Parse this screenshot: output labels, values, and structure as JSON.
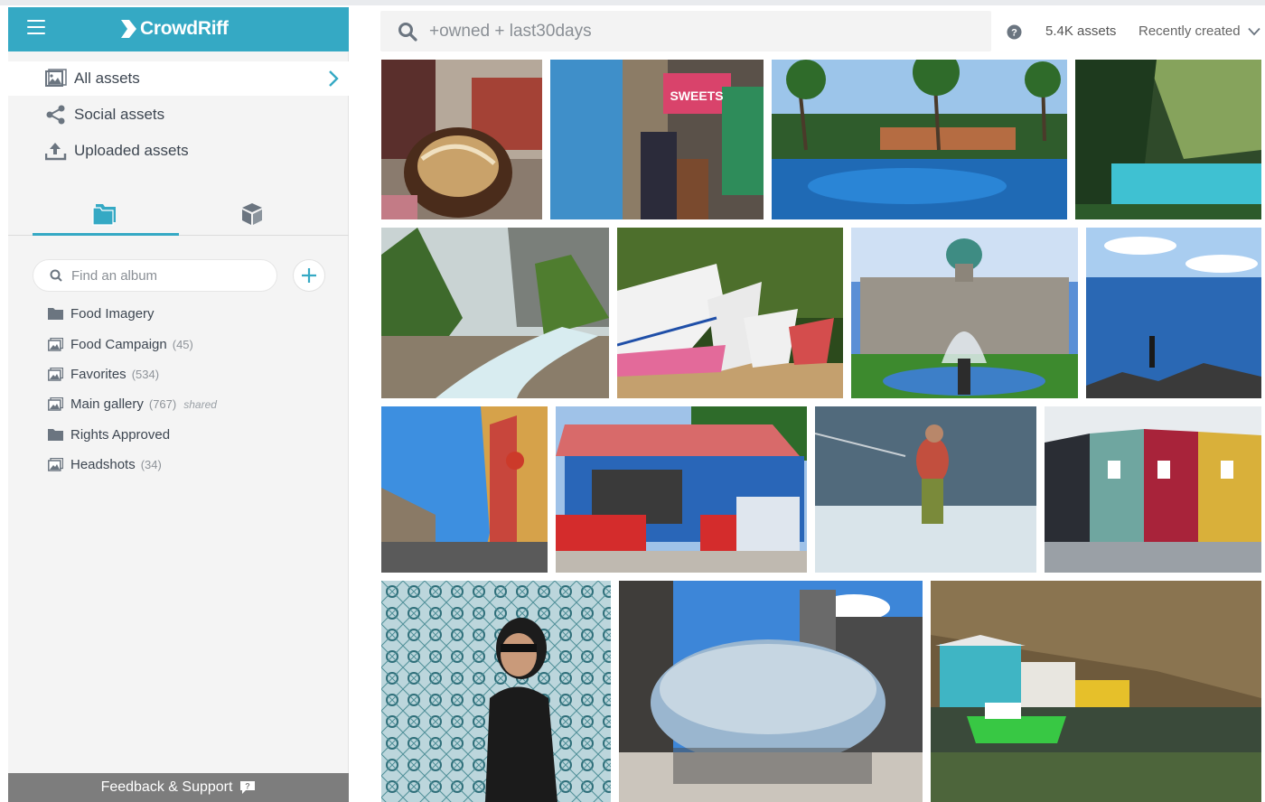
{
  "app": {
    "brand_name": "CrowdRiff",
    "brand_color": "#35a9c4"
  },
  "nav": {
    "items": [
      {
        "label": "All assets",
        "icon": "image-icon",
        "active": true
      },
      {
        "label": "Social assets",
        "icon": "share-icon",
        "active": false
      },
      {
        "label": "Uploaded assets",
        "icon": "upload-icon",
        "active": false
      }
    ]
  },
  "tabs": [
    {
      "icon": "folder-icon",
      "active": true
    },
    {
      "icon": "cube-icon",
      "active": false
    }
  ],
  "album_search": {
    "placeholder": "Find an album"
  },
  "albums": [
    {
      "name": "Food Imagery",
      "icon": "folder-icon",
      "count": "",
      "shared": ""
    },
    {
      "name": "Food Campaign",
      "icon": "gallery-icon",
      "count": "(45)",
      "shared": ""
    },
    {
      "name": "Favorites",
      "icon": "gallery-icon",
      "count": "(534)",
      "shared": ""
    },
    {
      "name": "Main gallery",
      "icon": "gallery-icon",
      "count": "(767)",
      "shared": "shared"
    },
    {
      "name": "Rights Approved",
      "icon": "folder-icon",
      "count": "",
      "shared": ""
    },
    {
      "name": "Headshots",
      "icon": "gallery-icon",
      "count": "(34)",
      "shared": ""
    }
  ],
  "footer": {
    "feedback_label": "Feedback & Support"
  },
  "search": {
    "query": "+owned + last30days"
  },
  "results": {
    "count_label": "5.4K assets",
    "sort_label": "Recently created"
  },
  "photos": [
    {
      "subject": "donut-photo"
    },
    {
      "subject": "street-market-photo"
    },
    {
      "subject": "resort-pool-photo"
    },
    {
      "subject": "mountain-lake-photo"
    },
    {
      "subject": "forest-river-photo"
    },
    {
      "subject": "fishing-boats-photo"
    },
    {
      "subject": "parliament-fountain-photo"
    },
    {
      "subject": "ocean-overlook-photo"
    },
    {
      "subject": "city-street-photo"
    },
    {
      "subject": "blue-shop-photo"
    },
    {
      "subject": "waterski-photo"
    },
    {
      "subject": "row-houses-photo"
    },
    {
      "subject": "tile-wall-portrait-photo"
    },
    {
      "subject": "bean-sculpture-photo"
    },
    {
      "subject": "harbour-houses-photo"
    }
  ]
}
